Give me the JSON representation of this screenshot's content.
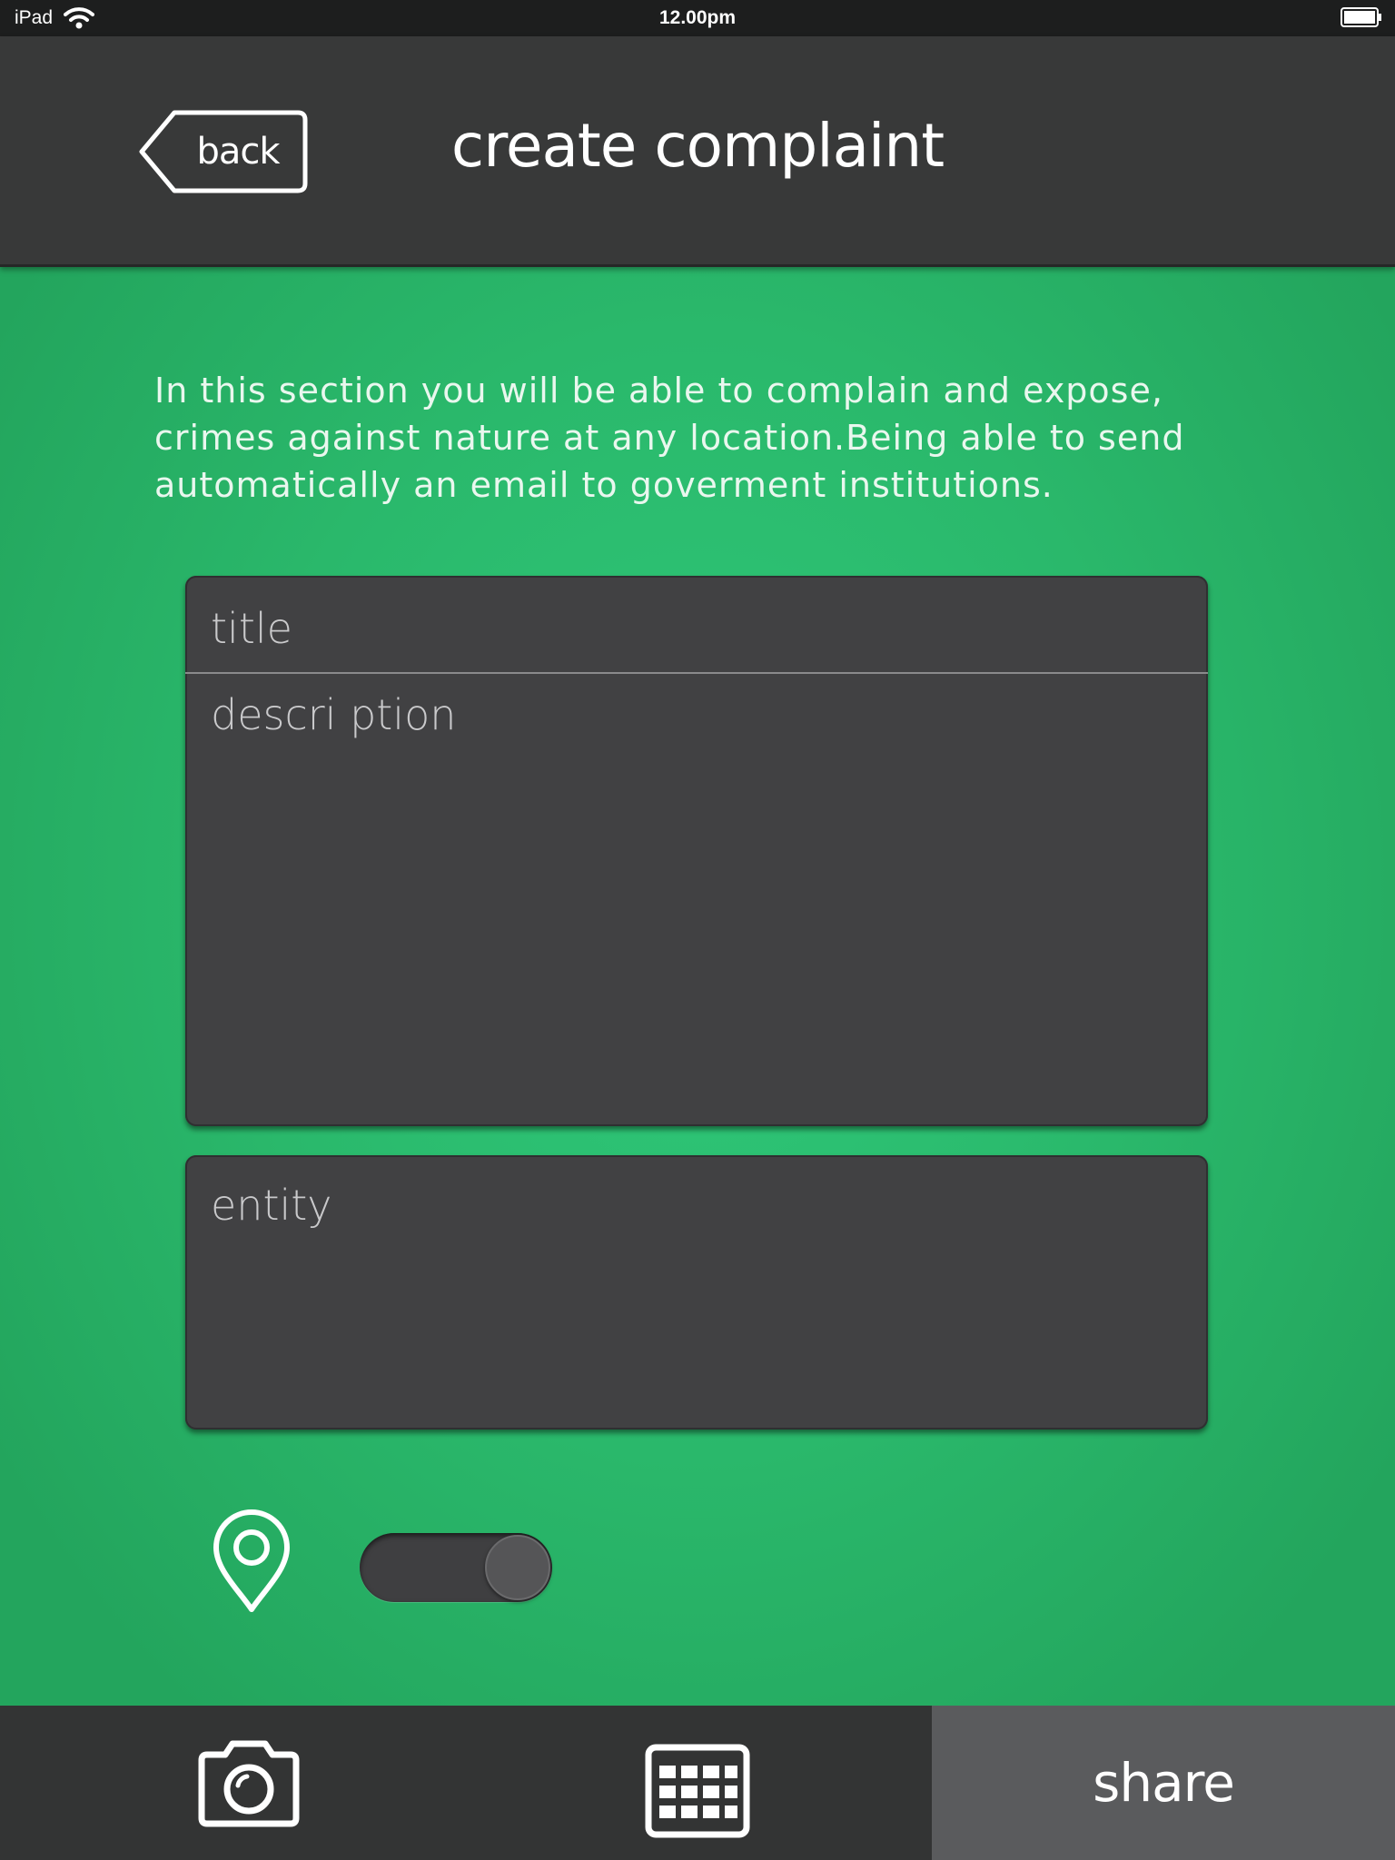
{
  "status_bar": {
    "carrier": "iPad",
    "time": "12.00pm"
  },
  "header": {
    "back_label": "back",
    "title": "create  complaint"
  },
  "intro": {
    "text": "In this section you will be able to complain and expose, crimes against nature at any location.Being able to send automatically an email to goverment institutions."
  },
  "form": {
    "title_placeholder": "title",
    "description_placeholder": "descri ption",
    "entity_placeholder": "entity",
    "location_toggle_on": true
  },
  "tabbar": {
    "camera_icon": "camera-icon",
    "calendar_icon": "calendar-icon",
    "share_label": "share"
  },
  "colors": {
    "background_green": "#2ab86b",
    "header_bg": "#383939",
    "card_bg": "#414143",
    "tabbar_bg": "#333434",
    "share_bg": "#5a5b5d"
  }
}
